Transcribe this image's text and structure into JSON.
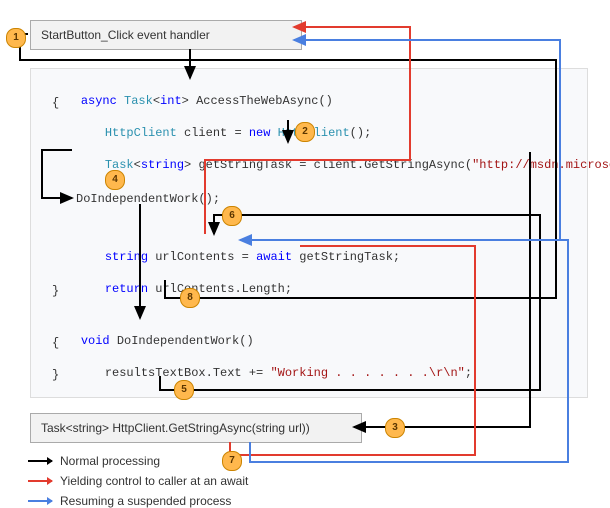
{
  "boxes": {
    "start_handler": "StartButton_Click event handler",
    "getstring": "Task<string> HttpClient.GetStringAsync(string url))"
  },
  "code": {
    "sig_async": "async",
    "sig_task": "Task",
    "sig_int": "int",
    "sig_name": "AccessTheWebAsync()",
    "open1": "{",
    "httpclient_type": "HttpClient",
    "httpclient_decl": "client =",
    "new": "new",
    "httpclient_ctor": "HttpClient();",
    "task": "Task",
    "string": "string",
    "gst_line": "getStringTask = client.GetStringAsync(",
    "url": "\"http://msdn.microsoft.com\"",
    "gst_end": ");",
    "doindep_call": "DoIndependentWork();",
    "str_kw": "string",
    "urlc": "urlContents =",
    "await": "await",
    "gst_var": "getStringTask;",
    "return": "return",
    "return_expr": "urlContents.Length;",
    "close1": "}",
    "void": "void",
    "doindep_sig": "DoIndependentWork()",
    "open2": "{",
    "results_line": "resultsTextBox.Text +=",
    "results_str": "\"Working . . . . . . .\\r\\n\"",
    "results_end": ";",
    "close2": "}"
  },
  "badges": {
    "b1": "1",
    "b2": "2",
    "b3": "3",
    "b4": "4",
    "b5": "5",
    "b6": "6",
    "b7": "7",
    "b8": "8"
  },
  "legend": {
    "normal": "Normal processing",
    "yield": "Yielding control to caller at an await",
    "resume": "Resuming a suspended process"
  }
}
